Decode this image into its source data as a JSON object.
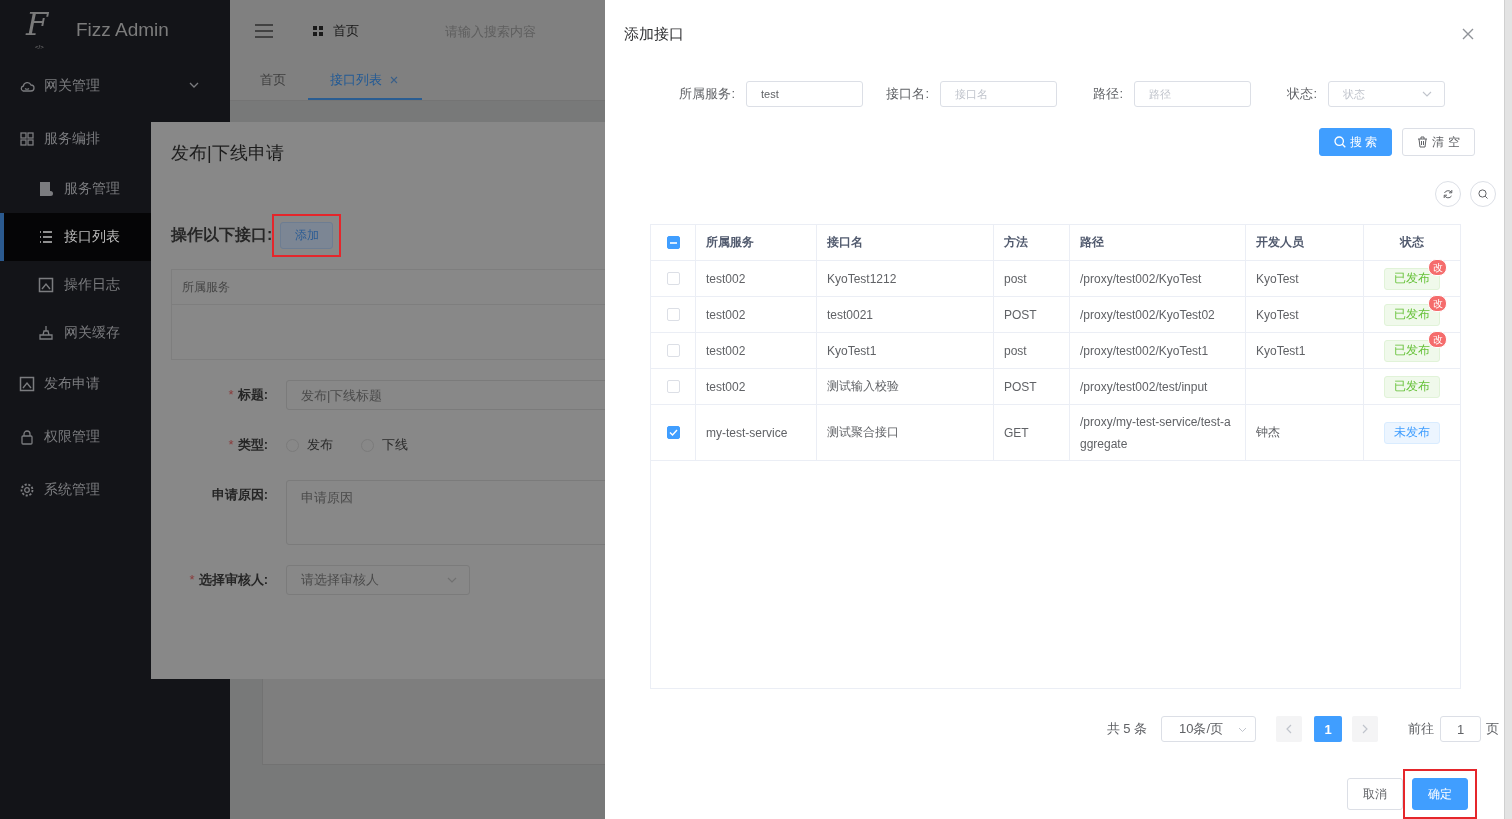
{
  "sidebar": {
    "logo_mark": "F",
    "logo_mark_sub": "</>",
    "logo_text": "Fizz Admin",
    "items": [
      {
        "label": "网关管理",
        "expanded": false,
        "selected": false
      },
      {
        "label": "服务编排",
        "selected": false,
        "children": [
          {
            "label": "服务管理",
            "selected": false
          },
          {
            "label": "接口列表",
            "selected": true
          },
          {
            "label": "操作日志",
            "selected": false
          },
          {
            "label": "网关缓存",
            "selected": false
          }
        ]
      },
      {
        "label": "发布申请",
        "selected": false
      },
      {
        "label": "权限管理",
        "selected": false
      },
      {
        "label": "系统管理",
        "selected": false
      }
    ]
  },
  "header": {
    "breadcrumb": "首页",
    "search_placeholder": "请输入搜索内容"
  },
  "tabs": [
    {
      "label": "首页",
      "selected": false,
      "closable": false
    },
    {
      "label": "接口列表",
      "selected": true,
      "closable": true
    }
  ],
  "dialog": {
    "title": "发布|下线申请",
    "required_mark": "*",
    "section_label": "操作以下接口:",
    "add_button": {
      "label": "添加",
      "highlighted": true
    },
    "table_columns": [
      "所属服务"
    ],
    "fields": [
      {
        "kind": "input",
        "label": "标题:",
        "required": true,
        "placeholder": "发布|下线标题"
      },
      {
        "kind": "radio",
        "label": "类型:",
        "required": true,
        "options": [
          {
            "label": "发布",
            "selected": false
          },
          {
            "label": "下线",
            "selected": false
          }
        ]
      },
      {
        "kind": "textarea",
        "label": "申请原因:",
        "required": false,
        "placeholder": "申请原因"
      },
      {
        "kind": "select",
        "label": "选择审核人:",
        "required": true,
        "placeholder": "请选择审核人"
      }
    ]
  },
  "drawer": {
    "title": "添加接口",
    "filters": [
      {
        "kind": "input",
        "label": "所属服务:",
        "value": "test"
      },
      {
        "kind": "input",
        "label": "接口名:",
        "placeholder": "接口名"
      },
      {
        "kind": "input",
        "label": "路径:",
        "placeholder": "路径"
      },
      {
        "kind": "select",
        "label": "状态:",
        "placeholder": "状态"
      }
    ],
    "search_button": "搜 索",
    "clear_button": "清 空",
    "table": {
      "select_all": {
        "indeterminate": true
      },
      "columns": [
        "所属服务",
        "接口名",
        "方法",
        "路径",
        "开发人员",
        "状态"
      ],
      "rows": [
        {
          "checked": false,
          "service": "test002",
          "name": "KyoTest1212",
          "method": "post",
          "path": "/proxy/test002/KyoTest",
          "developer": "KyoTest",
          "status": {
            "label": "已发布",
            "kind": "published",
            "badge": "改"
          }
        },
        {
          "checked": false,
          "service": "test002",
          "name": "test0021",
          "method": "POST",
          "path": "/proxy/test002/KyoTest02",
          "developer": "KyoTest",
          "status": {
            "label": "已发布",
            "kind": "published",
            "badge": "改"
          }
        },
        {
          "checked": false,
          "service": "test002",
          "name": "KyoTest1",
          "method": "post",
          "path": "/proxy/test002/KyoTest1",
          "developer": "KyoTest1",
          "status": {
            "label": "已发布",
            "kind": "published",
            "badge": "改"
          }
        },
        {
          "checked": false,
          "service": "test002",
          "name": "测试输入校验",
          "method": "POST",
          "path": "/proxy/test002/test/input",
          "status": {
            "label": "已发布",
            "kind": "published"
          }
        },
        {
          "checked": true,
          "service": "my-test-service",
          "name": "测试聚合接口",
          "method": "GET",
          "path": "/proxy/my-test-service/test-aggregate",
          "developer": "钟杰",
          "status": {
            "label": "未发布",
            "kind": "unpublished"
          }
        }
      ]
    },
    "pagination": {
      "total": "共 5 条",
      "page_size": "10条/页",
      "pages": [
        {
          "label": "1",
          "selected": true
        }
      ],
      "goto_label": "前往",
      "goto_value": "1",
      "goto_suffix": "页"
    },
    "footer": {
      "cancel": "取消",
      "confirm": {
        "label": "确定",
        "highlighted": true
      }
    }
  }
}
